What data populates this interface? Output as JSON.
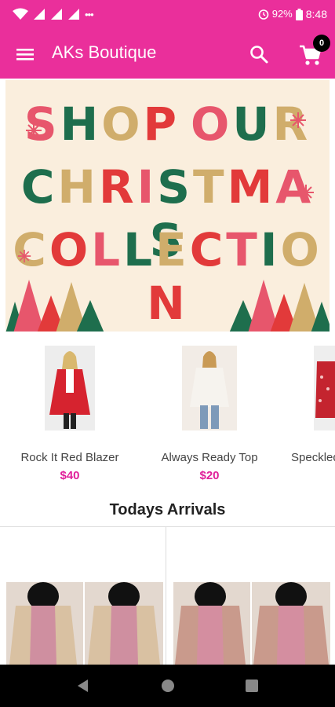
{
  "status_bar": {
    "battery_percent": "92%",
    "time": "8:48",
    "icons": [
      "wifi-icon",
      "signal-icon",
      "signal-icon",
      "signal-icon",
      "more-notifications-icon",
      "alarm-icon",
      "battery-icon"
    ]
  },
  "app_bar": {
    "title": "AKs Boutique",
    "cart_count": "0",
    "background": "#ea2f9b"
  },
  "banner": {
    "lines": [
      "SHOP OUR",
      "CHRISTMAS",
      "COLLECTION"
    ],
    "colors": [
      "#e7566c",
      "#1e6e4d",
      "#d0ad6b",
      "#e23a3a"
    ],
    "background": "#faeedd"
  },
  "products": [
    {
      "name": "Rock It Red Blazer",
      "price": "$40",
      "image": "red-blazer-photo"
    },
    {
      "name": "Always Ready Top",
      "price": "$20",
      "image": "white-top-photo"
    },
    {
      "name": "Speckled",
      "price": "",
      "image": "speckled-photo"
    }
  ],
  "section": {
    "title": "Todays Arrivals"
  },
  "arrivals": [
    {
      "image": "cardigan-photo-1"
    },
    {
      "image": "cardigan-photo-2"
    }
  ],
  "colors": {
    "accent": "#ea2f9b",
    "price": "#e0209a"
  }
}
